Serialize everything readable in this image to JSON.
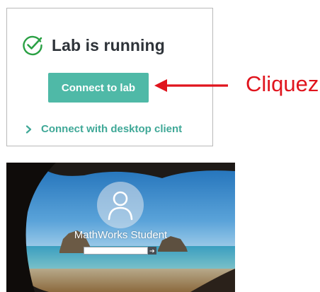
{
  "lab_panel": {
    "status_icon": "check-circle-icon",
    "status_text": "Lab is running",
    "connect_button_label": "Connect to lab",
    "desktop_link_icon": "chevron-right-icon",
    "desktop_link_label": "Connect with desktop client",
    "accent_color": "#4fb9a7"
  },
  "annotation": {
    "arrow_icon": "left-arrow-icon",
    "label": "Cliquez",
    "color": "#e0141d"
  },
  "login_screen": {
    "avatar_icon": "user-icon",
    "username": "MathWorks Student",
    "password_placeholder": "",
    "submit_icon": "arrow-right-icon"
  }
}
